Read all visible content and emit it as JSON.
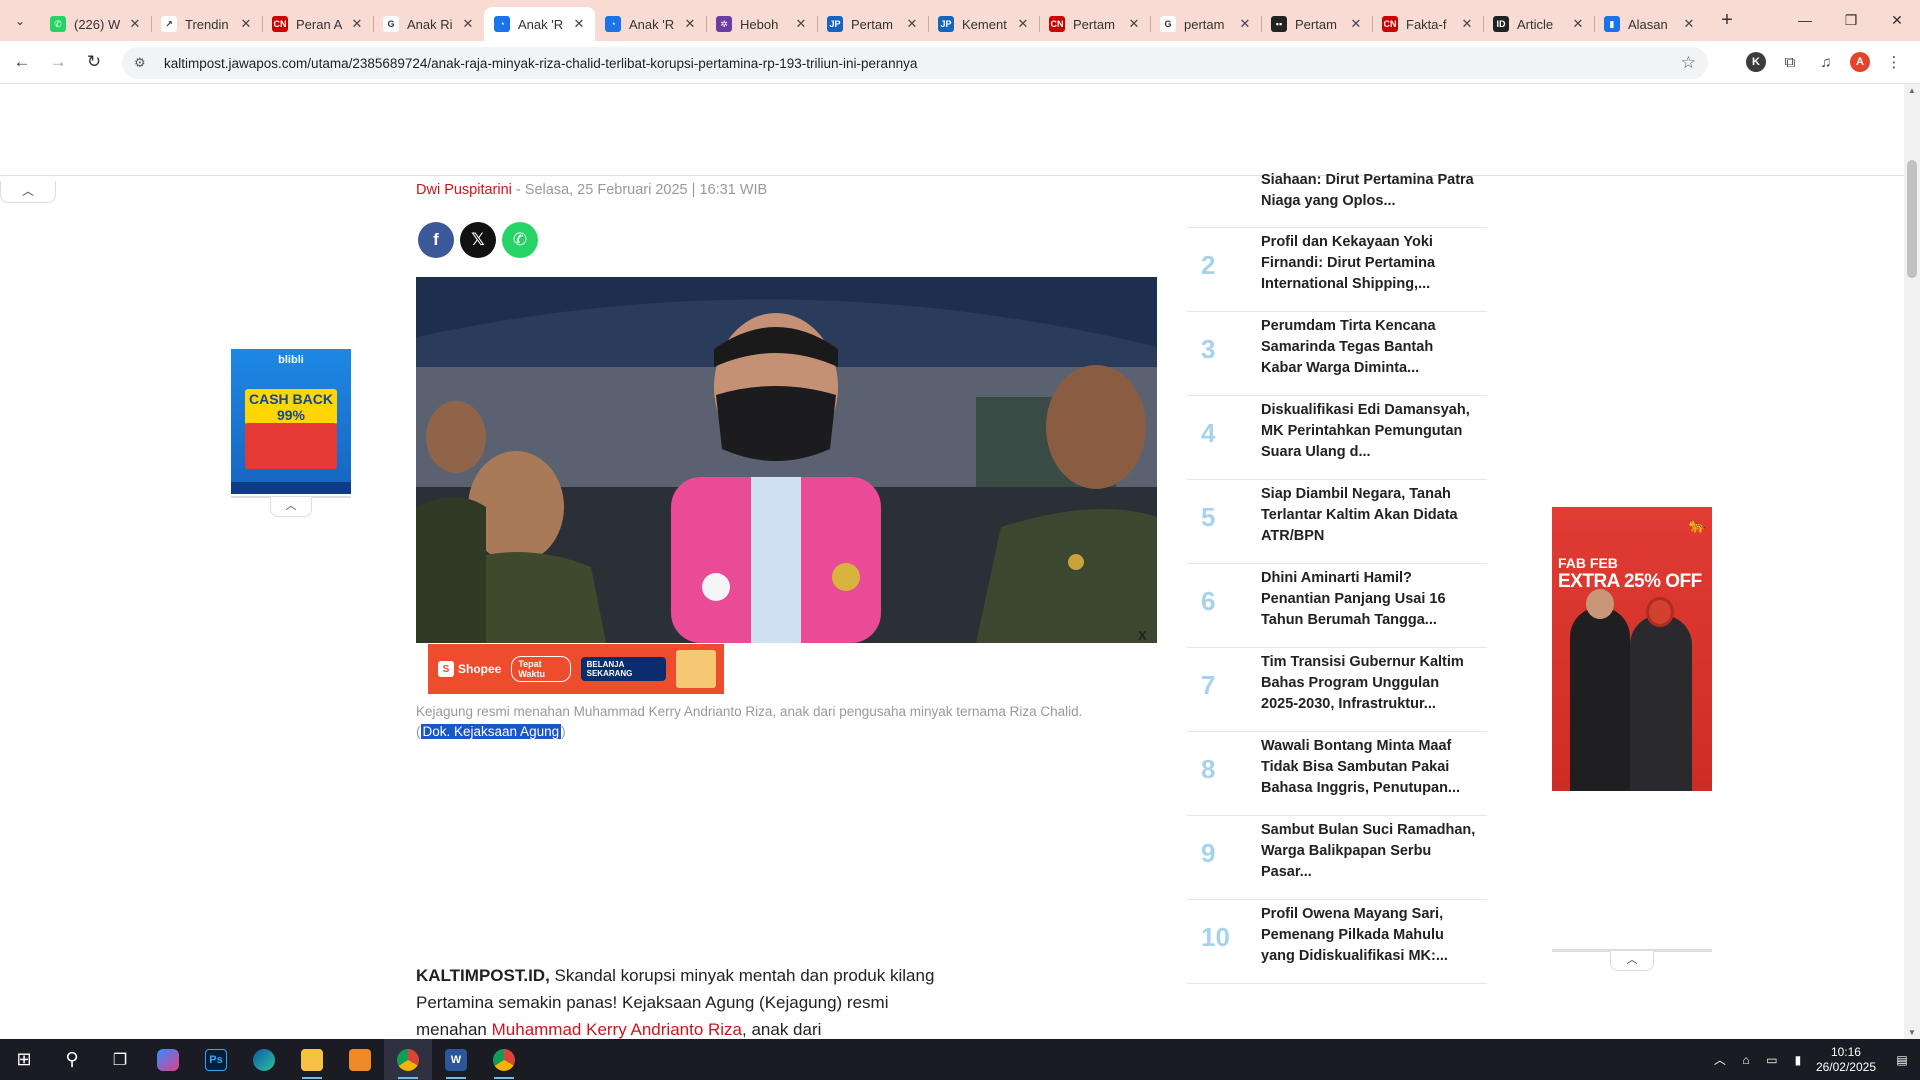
{
  "browser": {
    "tabs": [
      {
        "title": "(226) W",
        "favicon": "whatsapp-icon",
        "color": "#25d366",
        "glyph": "✆"
      },
      {
        "title": "Trendin",
        "favicon": "trending-icon",
        "color": "#ffffff",
        "glyph": "↗"
      },
      {
        "title": "Peran A",
        "favicon": "cnn-icon",
        "color": "#cc0000",
        "glyph": "CN"
      },
      {
        "title": "Anak Ri",
        "favicon": "google-icon",
        "color": "#ffffff",
        "glyph": "G"
      },
      {
        "title": "Anak 'R",
        "favicon": "site-icon",
        "color": "#1a73e8",
        "glyph": "◔",
        "active": true
      },
      {
        "title": "Anak 'R",
        "favicon": "site-icon",
        "color": "#1a73e8",
        "glyph": "◔"
      },
      {
        "title": "Heboh",
        "favicon": "nbc-icon",
        "color": "#6a3da3",
        "glyph": "✲"
      },
      {
        "title": "Pertam",
        "favicon": "jp-icon",
        "color": "#1565c0",
        "glyph": "JP"
      },
      {
        "title": "Kement",
        "favicon": "jp-icon",
        "color": "#1565c0",
        "glyph": "JP"
      },
      {
        "title": "Pertam",
        "favicon": "cnn-icon",
        "color": "#cc0000",
        "glyph": "CN"
      },
      {
        "title": "pertam",
        "favicon": "google-icon",
        "color": "#ffffff",
        "glyph": "G"
      },
      {
        "title": "Pertam",
        "favicon": "dots-icon",
        "color": "#222222",
        "glyph": "▪▪"
      },
      {
        "title": "Fakta-f",
        "favicon": "cnn-icon",
        "color": "#cc0000",
        "glyph": "CN"
      },
      {
        "title": "Article",
        "favicon": "id-icon",
        "color": "#222222",
        "glyph": "ID"
      },
      {
        "title": "Alasan",
        "favicon": "doc-icon",
        "color": "#1a73e8",
        "glyph": "▮"
      }
    ],
    "url": "kaltimpost.jawapos.com/utama/2385689724/anak-raja-minyak-riza-chalid-terlibat-korupsi-pertamina-rp-193-triliun-ini-perannya",
    "profile_k": "K",
    "profile_a": "A"
  },
  "article": {
    "author": "Dwi Puspitarini",
    "date": " - Selasa, 25 Februari 2025 | 16:31 WIB",
    "share": [
      {
        "name": "facebook",
        "glyph": "f",
        "color": "#3b5998"
      },
      {
        "name": "x",
        "glyph": "𝕏",
        "color": "#111111"
      },
      {
        "name": "whatsapp",
        "glyph": "✆",
        "color": "#25d366"
      }
    ],
    "ad_close": "X",
    "caption_text": "Kejagung resmi menahan Muhammad Kerry Andrianto Riza, anak dari pengusaha minyak ternama Riza Chalid.",
    "caption_open": "(",
    "caption_credit": "Dok. Kejaksaan Agung",
    "caption_close": ")",
    "body_lead": "KALTIMPOST.ID,",
    "body_text_1": " Skandal korupsi minyak mentah dan produk kilang Pertamina semakin panas! Kejaksaan Agung (Kejagung) resmi menahan ",
    "body_link": "Muhammad Kerry Andrianto Riza",
    "body_text_2": ", anak dari"
  },
  "popular": [
    {
      "num": "",
      "title": "Siahaan: Dirut Pertamina Patra Niaga yang Oplos..."
    },
    {
      "num": "2",
      "title": "Profil dan Kekayaan Yoki Firnandi: Dirut Pertamina International Shipping,..."
    },
    {
      "num": "3",
      "title": "Perumdam Tirta Kencana Samarinda Tegas Bantah Kabar Warga Diminta..."
    },
    {
      "num": "4",
      "title": "Diskualifikasi Edi Damansyah, MK Perintahkan Pemungutan Suara Ulang d..."
    },
    {
      "num": "5",
      "title": "Siap Diambil Negara, Tanah Terlantar Kaltim Akan Didata ATR/BPN"
    },
    {
      "num": "6",
      "title": "Dhini Aminarti Hamil? Penantian Panjang Usai 16 Tahun Berumah Tangga..."
    },
    {
      "num": "7",
      "title": "Tim Transisi Gubernur Kaltim Bahas Program Unggulan 2025-2030, Infrastruktur..."
    },
    {
      "num": "8",
      "title": "Wawali Bontang Minta Maaf Tidak Bisa Sambutan Pakai Bahasa Inggris, Penutupan..."
    },
    {
      "num": "9",
      "title": "Sambut Bulan Suci Ramadhan, Warga Balikpapan Serbu Pasar..."
    },
    {
      "num": "10",
      "title": "Profil Owena Mayang Sari, Pemenang Pilkada Mahulu yang Didiskualifikasi MK:..."
    }
  ],
  "ads": {
    "blibli_brand": "blibli",
    "blibli_cash": "CASH BACK 99%",
    "puma_fab": "FAB FEB",
    "puma_off": "EXTRA 25% OFF",
    "shopee_brand": "Shopee",
    "shopee_pill": "Tepat Waktu",
    "shopee_cta": "BELANJA SEKARANG"
  },
  "taskbar": {
    "time": "10:16",
    "date": "26/02/2025"
  }
}
